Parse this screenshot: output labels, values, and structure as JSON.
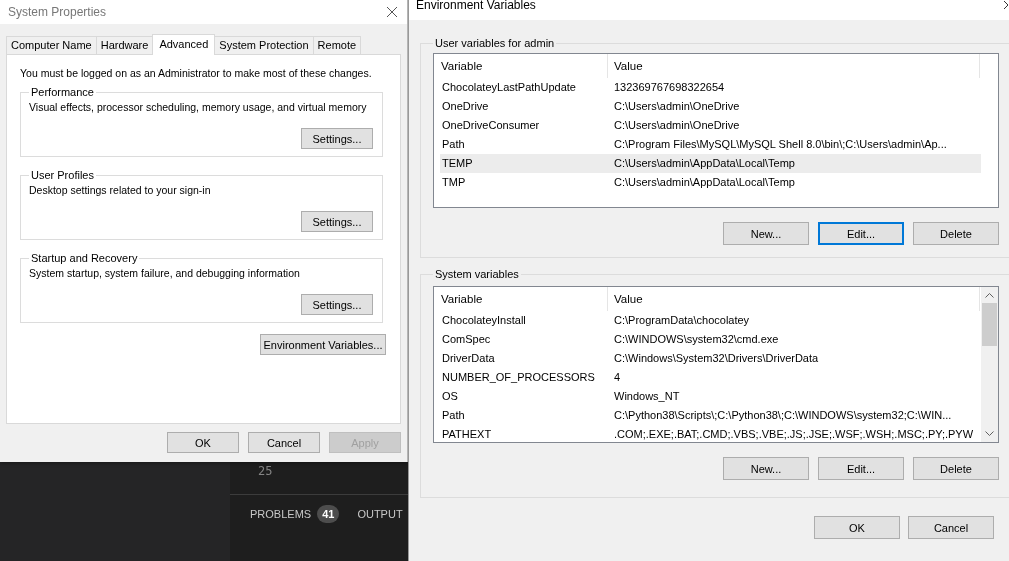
{
  "system_properties": {
    "title": "System Properties",
    "tabs": [
      {
        "label": "Computer Name",
        "selected": false
      },
      {
        "label": "Hardware",
        "selected": false
      },
      {
        "label": "Advanced",
        "selected": true
      },
      {
        "label": "System Protection",
        "selected": false
      },
      {
        "label": "Remote",
        "selected": false
      }
    ],
    "notice": "You must be logged on as an Administrator to make most of these changes.",
    "groups": [
      {
        "title": "Performance",
        "description": "Visual effects, processor scheduling, memory usage, and virtual memory",
        "button": "Settings..."
      },
      {
        "title": "User Profiles",
        "description": "Desktop settings related to your sign-in",
        "button": "Settings..."
      },
      {
        "title": "Startup and Recovery",
        "description": "System startup, system failure, and debugging information",
        "button": "Settings..."
      }
    ],
    "env_button": "Environment Variables...",
    "buttons": [
      {
        "label": "OK",
        "disabled": false
      },
      {
        "label": "Cancel",
        "disabled": false
      },
      {
        "label": "Apply",
        "disabled": true
      }
    ]
  },
  "editor_background": {
    "line_number": "25",
    "panel_tabs": [
      {
        "label": "PROBLEMS",
        "badge": "41"
      },
      {
        "label": "OUTPUT"
      }
    ]
  },
  "environment_variables": {
    "title": "Environment Variables",
    "user_group": {
      "title": "User variables for admin",
      "columns": [
        "Variable",
        "Value"
      ],
      "rows": [
        {
          "variable": "ChocolateyLastPathUpdate",
          "value": "132369767698322654",
          "selected": false
        },
        {
          "variable": "OneDrive",
          "value": "C:\\Users\\admin\\OneDrive",
          "selected": false
        },
        {
          "variable": "OneDriveConsumer",
          "value": "C:\\Users\\admin\\OneDrive",
          "selected": false
        },
        {
          "variable": "Path",
          "value": "C:\\Program Files\\MySQL\\MySQL Shell 8.0\\bin\\;C:\\Users\\admin\\Ap...",
          "selected": false
        },
        {
          "variable": "TEMP",
          "value": "C:\\Users\\admin\\AppData\\Local\\Temp",
          "selected": true
        },
        {
          "variable": "TMP",
          "value": "C:\\Users\\admin\\AppData\\Local\\Temp",
          "selected": false
        }
      ],
      "buttons": [
        {
          "label": "New...",
          "focused": false
        },
        {
          "label": "Edit...",
          "focused": true
        },
        {
          "label": "Delete",
          "focused": false
        }
      ]
    },
    "system_group": {
      "title": "System variables",
      "columns": [
        "Variable",
        "Value"
      ],
      "rows": [
        {
          "variable": "ChocolateyInstall",
          "value": "C:\\ProgramData\\chocolatey",
          "selected": false
        },
        {
          "variable": "ComSpec",
          "value": "C:\\WINDOWS\\system32\\cmd.exe",
          "selected": false
        },
        {
          "variable": "DriverData",
          "value": "C:\\Windows\\System32\\Drivers\\DriverData",
          "selected": false
        },
        {
          "variable": "NUMBER_OF_PROCESSORS",
          "value": "4",
          "selected": false
        },
        {
          "variable": "OS",
          "value": "Windows_NT",
          "selected": false
        },
        {
          "variable": "Path",
          "value": "C:\\Python38\\Scripts\\;C:\\Python38\\;C:\\WINDOWS\\system32;C:\\WIN...",
          "selected": false
        },
        {
          "variable": "PATHEXT",
          "value": ".COM;.EXE;.BAT;.CMD;.VBS;.VBE;.JS;.JSE;.WSF;.WSH;.MSC;.PY;.PYW",
          "selected": false
        }
      ],
      "buttons": [
        {
          "label": "New...",
          "focused": false
        },
        {
          "label": "Edit...",
          "focused": false
        },
        {
          "label": "Delete",
          "focused": false
        }
      ]
    },
    "buttons": [
      {
        "label": "OK",
        "focused": false
      },
      {
        "label": "Cancel",
        "focused": false
      }
    ]
  }
}
